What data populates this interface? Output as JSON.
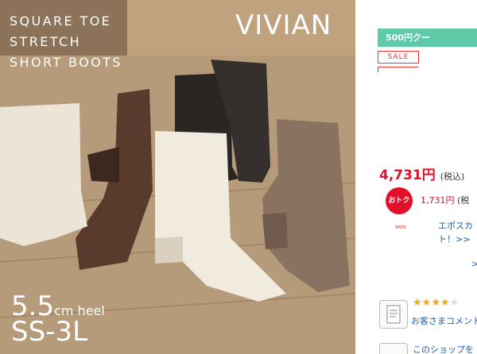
{
  "hero": {
    "tagline_line1": "SQUARE TOE",
    "tagline_line2": "STRETCH",
    "tagline_line3": "SHORT BOOTS",
    "brand": "VIVIAN",
    "heel_value": "5.5",
    "heel_unit": "cm heel",
    "size_range": "SS-3L"
  },
  "panel": {
    "coupon_label": "500円クー",
    "sale_badge": "SALE",
    "price": "4,731円",
    "price_tax": "(税込)",
    "otoku_badge": "おトク",
    "otoku_value": "1,731円",
    "otoku_tax": "(税",
    "epos_logo_text": "EPOS",
    "epos_link_line1": "エポスカ",
    "epos_link_line2": "ト！>>",
    "more_arrow": ">",
    "review_link": "お客さまコメント",
    "shop_link": "このショップを"
  },
  "colors": {
    "coupon_bg": "#5ecaa8",
    "price_red": "#e3102b",
    "link_blue": "#1a5fb4",
    "star": "#f2a81d"
  },
  "rating": {
    "filled": 4,
    "total": 5
  }
}
